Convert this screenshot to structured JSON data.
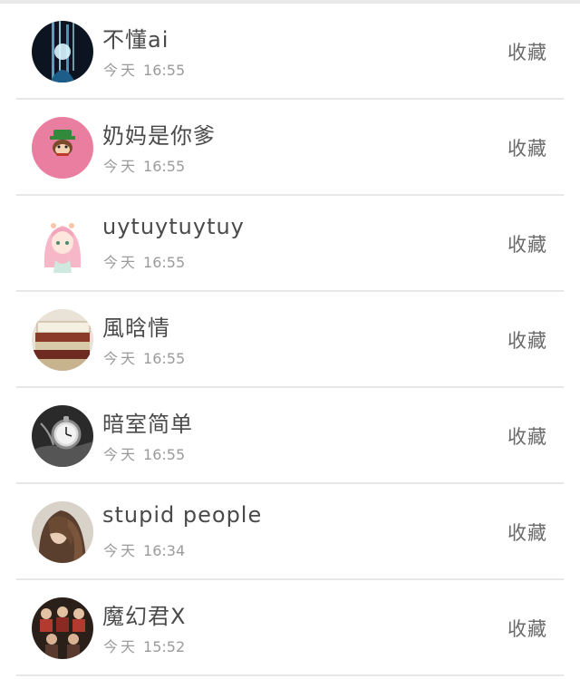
{
  "rows": [
    {
      "name": "不懂ai",
      "day": "今天",
      "time": "16:55",
      "action": "收藏",
      "avatar_icon": "avatar-dark-blue-figure"
    },
    {
      "name": "奶妈是你爹",
      "day": "今天",
      "time": "16:55",
      "action": "收藏",
      "avatar_icon": "avatar-pink-monkey"
    },
    {
      "name": "uytuytuytuy",
      "day": "今天",
      "time": "16:55",
      "action": "收藏",
      "avatar_icon": "avatar-anime-girl"
    },
    {
      "name": "風晗情",
      "day": "今天",
      "time": "16:55",
      "action": "收藏",
      "avatar_icon": "avatar-books"
    },
    {
      "name": "暗室简单",
      "day": "今天",
      "time": "16:55",
      "action": "收藏",
      "avatar_icon": "avatar-pocket-watch"
    },
    {
      "name": "stupid  people",
      "day": "今天",
      "time": "16:34",
      "action": "收藏",
      "avatar_icon": "avatar-girl-hair"
    },
    {
      "name": "魔幻君X",
      "day": "今天",
      "time": "15:52",
      "action": "收藏",
      "avatar_icon": "avatar-group-photo"
    }
  ]
}
